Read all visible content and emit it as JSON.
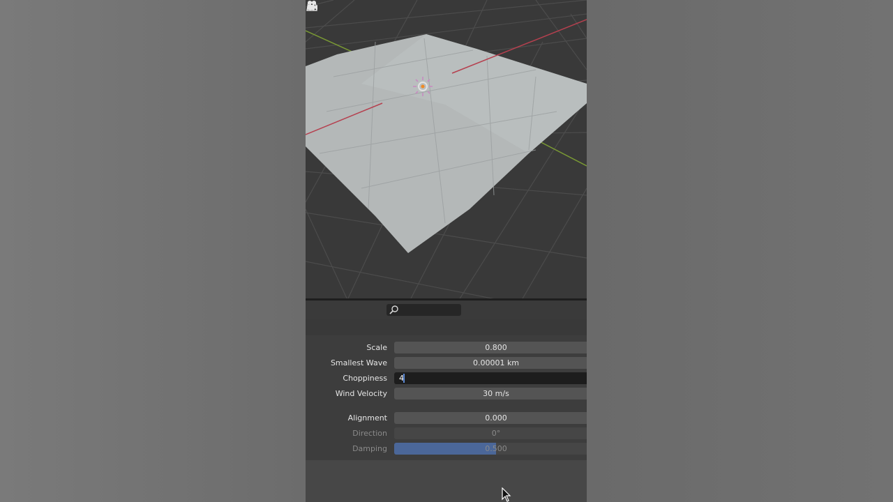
{
  "colors": {
    "viewport_bg": "#393939",
    "cloth_plane": "#b4b8b8",
    "axis_x": "#b5404f",
    "axis_y": "#7a9a34",
    "field_bg": "#545454",
    "field_active_bg": "#1d1d1d",
    "slider_fill": "#4b6799",
    "text": "#e6e6e6",
    "text_disabled": "#8a8a8a"
  },
  "viewport": {
    "overlay_icons": [
      "camera-icon",
      "grid-icon"
    ]
  },
  "search": {
    "placeholder": "",
    "icon": "search-icon"
  },
  "properties": {
    "scale": {
      "label": "Scale",
      "value": "0.800"
    },
    "smallest_wave": {
      "label": "Smallest Wave",
      "value": "0.00001 km"
    },
    "choppiness": {
      "label": "Choppiness",
      "value": "4"
    },
    "wind_velocity": {
      "label": "Wind Velocity",
      "value": "30 m/s"
    },
    "alignment": {
      "label": "Alignment",
      "value": "0.000"
    },
    "direction": {
      "label": "Direction",
      "value": "0°"
    },
    "damping": {
      "label": "Damping",
      "value": "0.500",
      "fill_fraction": 0.5
    }
  }
}
